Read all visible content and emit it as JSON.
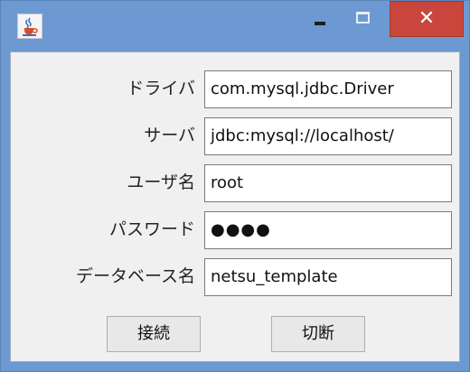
{
  "titlebar": {
    "icon": "java-cup-icon",
    "minimize_symbol": "",
    "maximize_symbol": "",
    "close_symbol": "✕"
  },
  "form": {
    "driver": {
      "label": "ドライバ",
      "value": "com.mysql.jdbc.Driver"
    },
    "server": {
      "label": "サーバ",
      "value": "jdbc:mysql://localhost/"
    },
    "username": {
      "label": "ユーザ名",
      "value": "root"
    },
    "password": {
      "label": "パスワード",
      "value": "●●●●"
    },
    "database": {
      "label": "データベース名",
      "value": "netsu_template"
    }
  },
  "buttons": {
    "connect": "接続",
    "disconnect": "切断"
  },
  "colors": {
    "titlebar": "#6d99d3",
    "close": "#c8463c",
    "client_bg": "#f0f0f0"
  }
}
